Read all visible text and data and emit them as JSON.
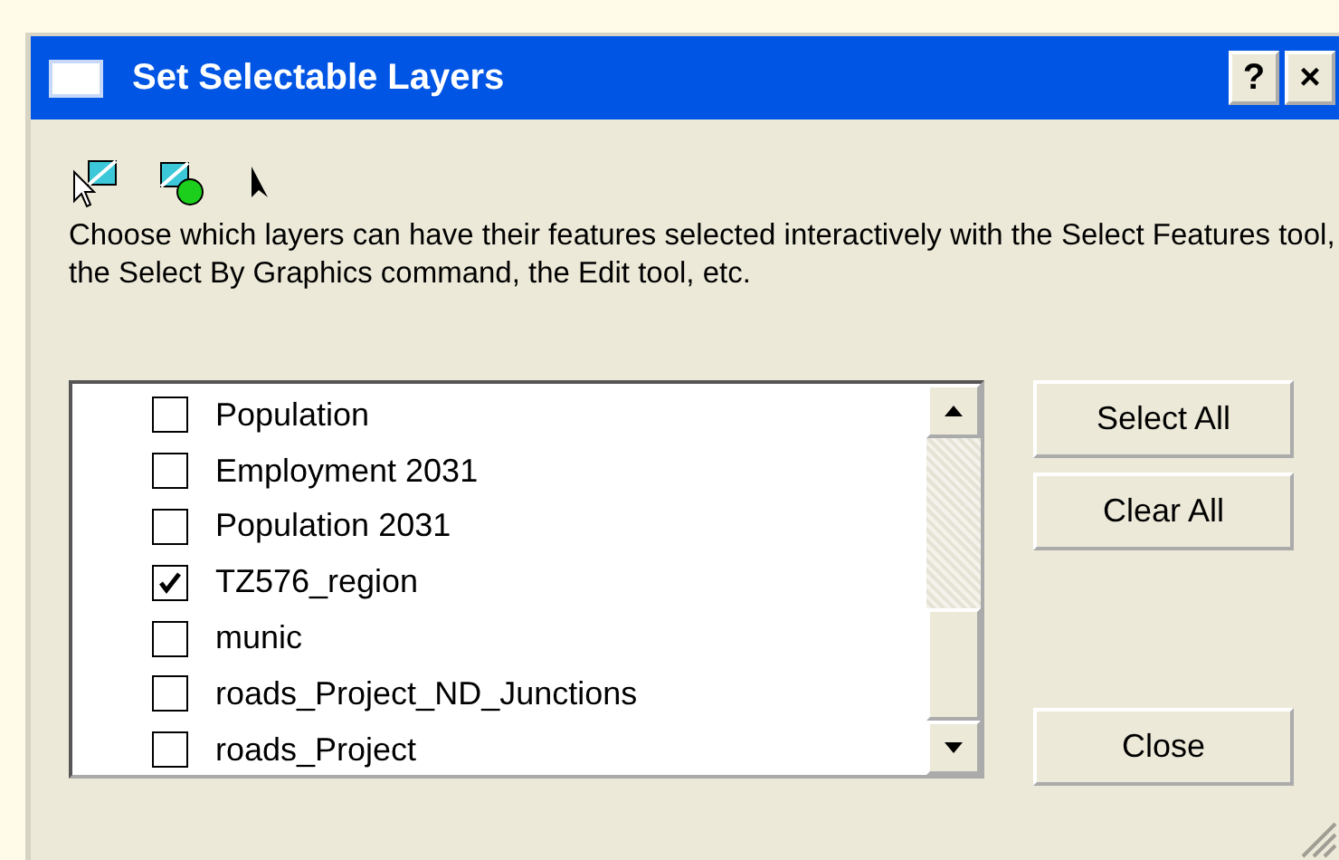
{
  "window": {
    "title": "Set Selectable Layers",
    "help": "?",
    "close": "×"
  },
  "description": "Choose which layers can have their features selected interactively with the Select Features tool, the Select By Graphics command, the Edit tool, etc.",
  "layers": [
    {
      "name": "Population",
      "checked": false
    },
    {
      "name": "Employment 2031",
      "checked": false
    },
    {
      "name": "Population 2031",
      "checked": false
    },
    {
      "name": "TZ576_region",
      "checked": true
    },
    {
      "name": "munic",
      "checked": false
    },
    {
      "name": "roads_Project_ND_Junctions",
      "checked": false
    },
    {
      "name": "roads_Project",
      "checked": false
    }
  ],
  "buttons": [
    "Select All",
    "Clear All",
    "Close"
  ]
}
